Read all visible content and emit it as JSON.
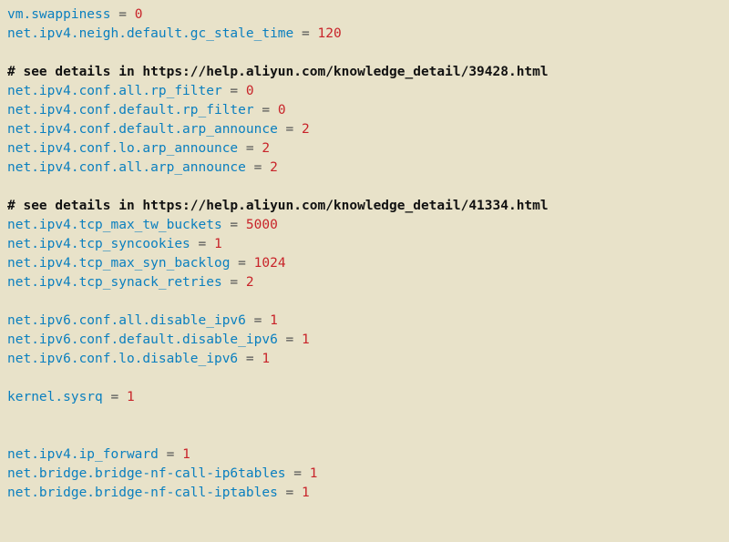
{
  "lines": [
    {
      "type": "kv",
      "key": "vm.swappiness",
      "value": "0"
    },
    {
      "type": "kv",
      "key": "net.ipv4.neigh.default.gc_stale_time",
      "value": "120"
    },
    {
      "type": "blank"
    },
    {
      "type": "comment",
      "text": "# see details in https://help.aliyun.com/knowledge_detail/39428.html"
    },
    {
      "type": "kv",
      "key": "net.ipv4.conf.all.rp_filter",
      "value": "0"
    },
    {
      "type": "kv",
      "key": "net.ipv4.conf.default.rp_filter",
      "value": "0"
    },
    {
      "type": "kv",
      "key": "net.ipv4.conf.default.arp_announce",
      "value": "2"
    },
    {
      "type": "kv",
      "key": "net.ipv4.conf.lo.arp_announce",
      "value": "2"
    },
    {
      "type": "kv",
      "key": "net.ipv4.conf.all.arp_announce",
      "value": "2"
    },
    {
      "type": "blank"
    },
    {
      "type": "comment",
      "text": "# see details in https://help.aliyun.com/knowledge_detail/41334.html"
    },
    {
      "type": "kv",
      "key": "net.ipv4.tcp_max_tw_buckets",
      "value": "5000"
    },
    {
      "type": "kv",
      "key": "net.ipv4.tcp_syncookies",
      "value": "1"
    },
    {
      "type": "kv",
      "key": "net.ipv4.tcp_max_syn_backlog",
      "value": "1024"
    },
    {
      "type": "kv",
      "key": "net.ipv4.tcp_synack_retries",
      "value": "2"
    },
    {
      "type": "blank"
    },
    {
      "type": "kv",
      "key": "net.ipv6.conf.all.disable_ipv6",
      "value": "1"
    },
    {
      "type": "kv",
      "key": "net.ipv6.conf.default.disable_ipv6",
      "value": "1"
    },
    {
      "type": "kv",
      "key": "net.ipv6.conf.lo.disable_ipv6",
      "value": "1"
    },
    {
      "type": "blank"
    },
    {
      "type": "kv",
      "key": "kernel.sysrq",
      "value": "1"
    },
    {
      "type": "blank"
    },
    {
      "type": "blank"
    },
    {
      "type": "kv",
      "key": "net.ipv4.ip_forward",
      "value": "1"
    },
    {
      "type": "kv",
      "key": "net.bridge.bridge-nf-call-ip6tables",
      "value": "1"
    },
    {
      "type": "kv",
      "key": "net.bridge.bridge-nf-call-iptables",
      "value": "1"
    }
  ]
}
